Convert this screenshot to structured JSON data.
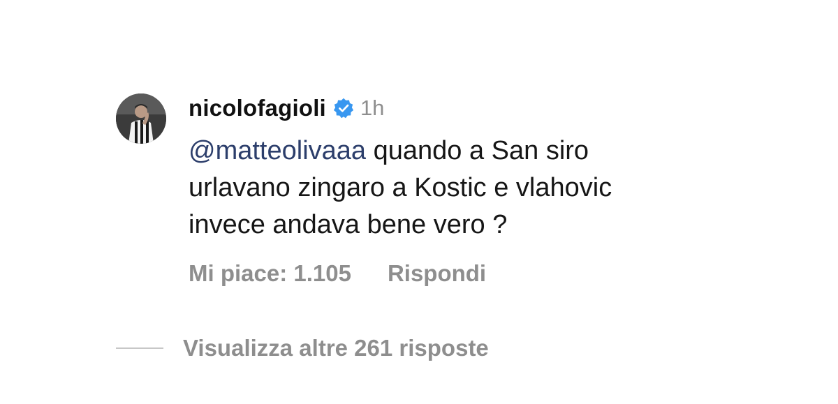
{
  "comment": {
    "username": "nicolofagioli",
    "verified_icon": "verified-badge-icon",
    "timestamp": "1h",
    "mention": "@matteolivaaa",
    "text": " quando a San siro urlavano zingaro a Kostic e vlahovic invece andava bene vero ?",
    "likes_label": "Mi piace: 1.105",
    "reply_label": "Rispondi",
    "accent_color": "#3897f0"
  },
  "replies": {
    "view_more_label": "Visualizza altre 261 risposte"
  }
}
